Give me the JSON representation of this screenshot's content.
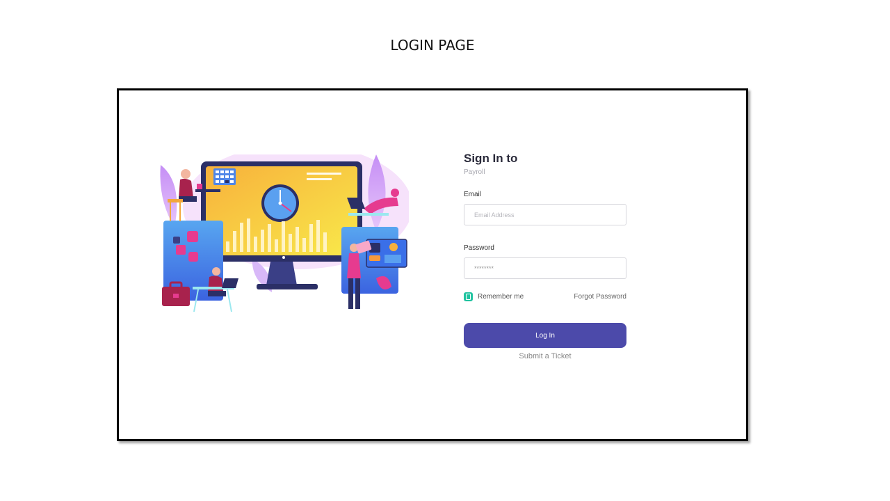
{
  "slide": {
    "title": "LOGIN PAGE"
  },
  "form": {
    "heading": "Sign In to",
    "subheading": "Payroll",
    "email_label": "Email",
    "email_placeholder": "Email Address",
    "password_label": "Password",
    "password_value": "********",
    "remember_label": "Remember me",
    "remember_checked": true,
    "forgot_label": "Forgot Password",
    "login_label": "Log In",
    "ticket_label": "Submit a Ticket"
  },
  "colors": {
    "primary_button": "#4c4aaa",
    "checkbox": "#22c3a0"
  },
  "illustration": {
    "icon": "office-dashboard-illustration",
    "elements": [
      "monitor-icon",
      "clock-icon",
      "calendar-icon",
      "bar-chart-icon",
      "briefcase-icon",
      "person-icon",
      "laptop-icon"
    ]
  }
}
